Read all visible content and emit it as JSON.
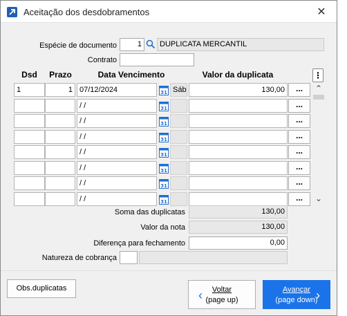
{
  "window": {
    "title": "Aceitação dos desdobramentos",
    "close_glyph": "✕"
  },
  "form": {
    "especie_label": "Espécie de documento",
    "especie_code": "1",
    "especie_name": "DUPLICATA MERCANTIL",
    "contrato_label": "Contrato",
    "contrato_value": ""
  },
  "table": {
    "headers": {
      "dsd": "Dsd",
      "prazo": "Prazo",
      "data": "Data Vencimento",
      "valor": "Valor da duplicata"
    },
    "rows": [
      {
        "dsd": "1",
        "prazo": "1",
        "date": "07/12/2024",
        "weekday": "Sáb",
        "valor": "130,00",
        "btn": "..."
      },
      {
        "dsd": "",
        "prazo": "",
        "date": " / /",
        "weekday": "",
        "valor": "",
        "btn": "..."
      },
      {
        "dsd": "",
        "prazo": "",
        "date": " / /",
        "weekday": "",
        "valor": "",
        "btn": "..."
      },
      {
        "dsd": "",
        "prazo": "",
        "date": " / /",
        "weekday": "",
        "valor": "",
        "btn": "..."
      },
      {
        "dsd": "",
        "prazo": "",
        "date": " / /",
        "weekday": "",
        "valor": "",
        "btn": "..."
      },
      {
        "dsd": "",
        "prazo": "",
        "date": " / /",
        "weekday": "",
        "valor": "",
        "btn": "..."
      },
      {
        "dsd": "",
        "prazo": "",
        "date": " / /",
        "weekday": "",
        "valor": "",
        "btn": "..."
      },
      {
        "dsd": "",
        "prazo": "",
        "date": " / /",
        "weekday": "",
        "valor": "",
        "btn": "..."
      }
    ],
    "menu_glyph": "⋮",
    "scroll_up_glyph": "⌃",
    "scroll_down_glyph": "⌄"
  },
  "summary": {
    "soma_label": "Soma das duplicatas",
    "soma_value": "130,00",
    "nota_label": "Valor da nota",
    "nota_value": "130,00",
    "dif_label": "Diferença para fechamento",
    "dif_value": "0,00",
    "natureza_label": "Natureza de cobrança",
    "natureza_code": "",
    "natureza_name": ""
  },
  "footer": {
    "obs_label": "Obs.duplicatas",
    "voltar_label": "Voltar",
    "voltar_sub": "(page up)",
    "avancar_label": "Avançar",
    "avancar_sub": "(page down)",
    "left_arrow": "‹",
    "right_arrow": "›"
  },
  "colors": {
    "accent": "#1a73e8",
    "icon_blue": "#1f5fb4"
  }
}
